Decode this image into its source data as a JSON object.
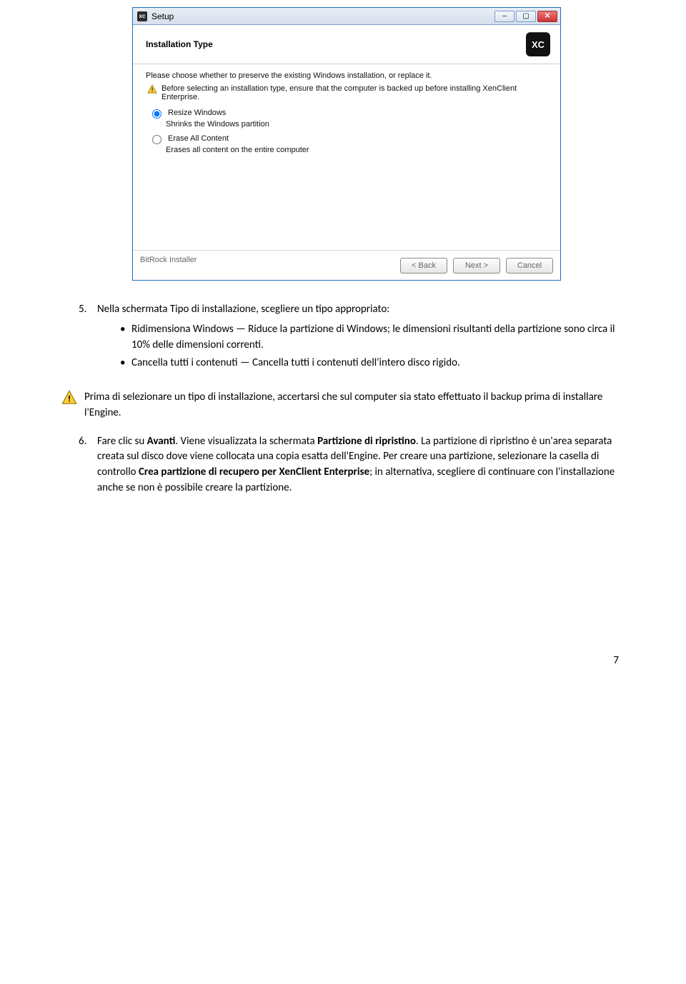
{
  "installer": {
    "window_title": "Setup",
    "header_title": "Installation Type",
    "logo_text": "XC",
    "prompt": "Please choose whether to preserve the existing Windows installation, or replace it.",
    "warning": "Before selecting an installation type, ensure that the computer is backed up before installing XenClient Enterprise.",
    "option1_label": "Resize Windows",
    "option1_desc": "Shrinks the Windows partition",
    "option2_label": "Erase All Content",
    "option2_desc": "Erases all content on the entire computer",
    "footer_label": "BitRock Installer",
    "back_btn": "< Back",
    "next_btn": "Next >",
    "cancel_btn": "Cancel"
  },
  "doc": {
    "item5": {
      "num": "5.",
      "lead": "Nella schermata Tipo di installazione, scegliere un tipo appropriato:",
      "bullet1_a": "Ridimensiona Windows — Riduce la partizione di Windows; le dimensioni risultanti della partizione sono circa il 10% delle dimensioni correnti.",
      "bullet2_a": "Cancella tutti i contenuti — Cancella tutti i contenuti dell'intero disco rigido."
    },
    "warn_para": "Prima di selezionare un tipo di installazione, accertarsi che sul computer sia stato effettuato il backup prima di installare l'Engine.",
    "item6": {
      "num": "6.",
      "t1": "Fare clic su ",
      "b1": "Avanti",
      "t2": ". Viene visualizzata la schermata ",
      "b2": "Partizione di ripristino",
      "t3": ". La partizione di ripristino è un'area separata creata sul disco dove viene collocata una copia esatta dell'Engine. Per creare una partizione, selezionare la casella di controllo ",
      "b3": "Crea partizione di recupero per XenClient Enterprise",
      "t4": "; in alternativa, scegliere di continuare con l'installazione anche se non è possibile creare la partizione."
    },
    "page_number": "7"
  }
}
